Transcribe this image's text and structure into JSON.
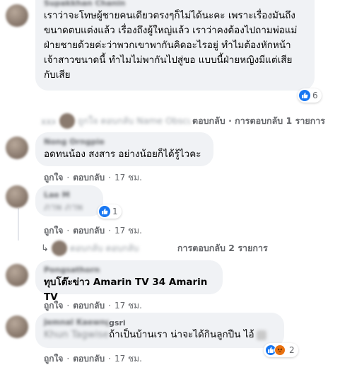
{
  "comments": [
    {
      "name": "Supakkhan Chanin",
      "lines": [
        "เราว่าจะโทษผู้ชายคนเดียวตรงๆก็ไม่ได้นะคะ เพราะเรื่องมันถึง",
        "ขนาดตบแต่งแล้ว เรื่องถึงผู้ใหญ่แล้ว เราว่าคงต้องไปถามพ่อแม่",
        "ฝ่ายชายด้วยค่ะว่าพวกเขาพากันคิดอะไรอยู่ ทำไมต้องหักหน้า",
        "เจ้าสาวขนาดนี้ ทำไมไม่พากันไปสู่ขอ แบบนี้ฝ่ายหญิงมีแต่เสีย",
        "กับเสีย"
      ],
      "reaction_count": "6",
      "replies_prefix": "ถูกใจ ตอบกลับ Name Obscured",
      "replies_link": "ตอบกลับ · การตอบกลับ 1 รายการ"
    },
    {
      "name": "Nong Orngpie",
      "text": "อดทนน้อง สงสาร อย่างน้อยก็ได้รู้ไวคะ",
      "like_label": "ถูกใจ",
      "reply_label": "ตอบกลับ",
      "time": "17 ชม."
    },
    {
      "name": "Lae M",
      "text": "ภาพ ภาพ",
      "reaction_count": "1",
      "like_label": "ถูกใจ",
      "reply_label": "ตอบกลับ",
      "time": "17 ชม.",
      "replies_prefix": "ตอบกลับ ตอบกลับ",
      "replies_link": "การตอบกลับ 2 รายการ"
    },
    {
      "name": "Pongsathorn",
      "text": "ทุบโต๊ะข่าว Amarin TV 34 Amarin TV",
      "like_label": "ถูกใจ",
      "reply_label": "ตอบกลับ",
      "time": "17 ชม."
    },
    {
      "name_obscured": "Jemnal Kaewngsri",
      "name_visible": "gsri",
      "tag_obscured": "Khun Tagwiset",
      "text": "ถ้าเป็นบ้านเรา น่าจะได้กินลูกปืน ไอ้",
      "reaction_count": "2",
      "like_label": "ถูกใจ",
      "reply_label": "ตอบกลับ",
      "time": "17 ชม."
    }
  ],
  "separator": "·",
  "colors": {
    "bubble": "#f0f2f5",
    "muted": "#65676b",
    "like": "#1877f2",
    "angry": "#f7b125"
  },
  "icons": {
    "like": "thumbs-up-icon",
    "angry": "angry-face-icon",
    "reply": "reply-arrow-icon"
  }
}
